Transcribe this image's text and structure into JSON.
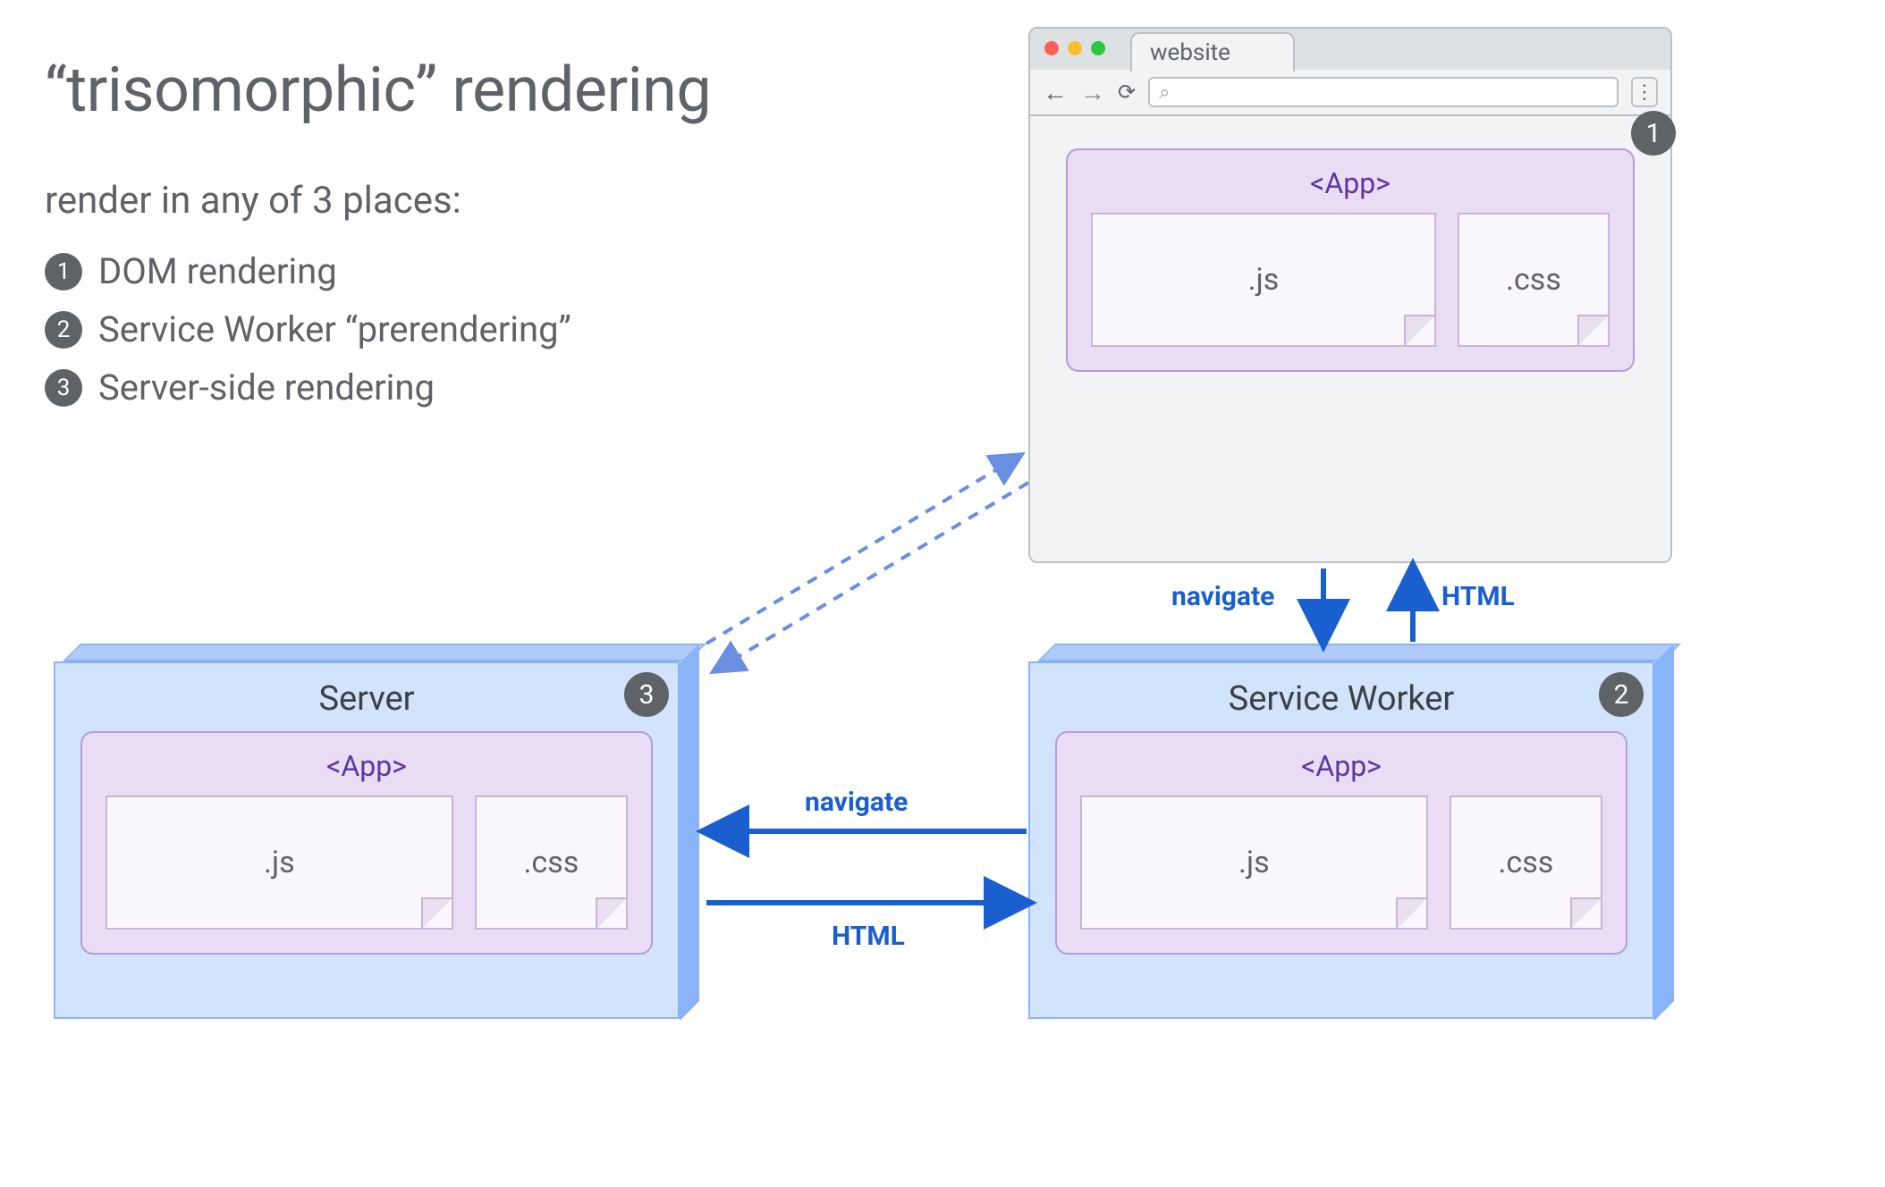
{
  "title": "“trisomorphic” rendering",
  "subtitle": "render in any of 3 places:",
  "list": [
    "DOM rendering",
    "Service Worker “prerendering”",
    "Server-side rendering"
  ],
  "browser": {
    "tab_label": "website",
    "badge": "1",
    "app": {
      "label": "<App>",
      "js": ".js",
      "css": ".css"
    }
  },
  "server": {
    "title": "Server",
    "badge": "3",
    "app": {
      "label": "<App>",
      "js": ".js",
      "css": ".css"
    }
  },
  "service_worker": {
    "title": "Service Worker",
    "badge": "2",
    "app": {
      "label": "<App>",
      "js": ".js",
      "css": ".css"
    }
  },
  "arrows": {
    "browser_to_sw": "navigate",
    "sw_to_browser": "HTML",
    "sw_to_server": "navigate",
    "server_to_sw": "HTML"
  }
}
